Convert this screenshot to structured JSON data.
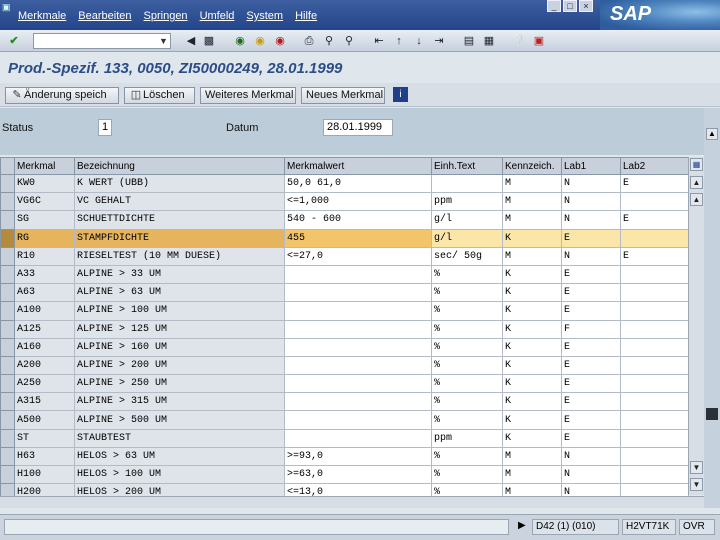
{
  "menu": [
    "Merkmale",
    "Bearbeiten",
    "Springen",
    "Umfeld",
    "System",
    "Hilfe"
  ],
  "brand": "SAP",
  "title": "Prod.-Spezif. 133, 0050, ZI50000249, 28.01.1999",
  "buttons": {
    "change_save": "Änderung speich",
    "delete": "Löschen",
    "more_feature": "Weiteres Merkmal",
    "new_feature": "Neues Merkmal"
  },
  "header": {
    "status_label": "Status",
    "status_value": "1",
    "date_label": "Datum",
    "date_value": "28.01.1999"
  },
  "table": {
    "columns": [
      "Merkmal",
      "Bezeichnung",
      "Merkmalwert",
      "Einh.Text",
      "Kennzeich.",
      "Lab1",
      "Lab2"
    ],
    "rows": [
      [
        "KW0",
        "K WERT (UBB)",
        "50,0   61,0",
        "",
        "M",
        "N",
        "E"
      ],
      [
        "VG6C",
        "VC GEHALT",
        "<=1,000",
        "ppm",
        "M",
        "N",
        ""
      ],
      [
        "SG",
        "SCHUETTDICHTE",
        "540 - 600",
        "g/l",
        "M",
        "N",
        "E"
      ],
      [
        "RG",
        "STAMPFDICHTE",
        "455",
        "g/l",
        "K",
        "E",
        ""
      ],
      [
        "R10",
        "RIESELTEST (10 MM DUESE)",
        "<=27,0",
        "sec/ 50g",
        "M",
        "N",
        "E"
      ],
      [
        "A33",
        "ALPINE >  33 UM",
        "",
        "%",
        "K",
        "E",
        ""
      ],
      [
        "A63",
        "ALPINE >  63 UM",
        "",
        "%",
        "K",
        "E",
        ""
      ],
      [
        "A100",
        "ALPINE > 100 UM",
        "",
        "%",
        "K",
        "E",
        ""
      ],
      [
        "A125",
        "ALPINE > 125 UM",
        "",
        "%",
        "K",
        "F",
        ""
      ],
      [
        "A160",
        "ALPINE > 160 UM",
        "",
        "%",
        "K",
        "E",
        ""
      ],
      [
        "A200",
        "ALPINE > 200 UM",
        "",
        "%",
        "K",
        "E",
        ""
      ],
      [
        "A250",
        "ALPINE > 250 UM",
        "",
        "%",
        "K",
        "E",
        ""
      ],
      [
        "A315",
        "ALPINE > 315 UM",
        "",
        "%",
        "K",
        "E",
        ""
      ],
      [
        "A500",
        "ALPINE > 500 UM",
        "",
        "%",
        "K",
        "E",
        ""
      ],
      [
        "ST",
        "STAUBTEST",
        "",
        "ppm",
        "K",
        "E",
        ""
      ],
      [
        "H63",
        "HELOS >  63 UM",
        ">=93,0",
        "%",
        "M",
        "N",
        ""
      ],
      [
        "H100",
        "HELOS > 100 UM",
        ">=63,0",
        "%",
        "M",
        "N",
        ""
      ],
      [
        "H200",
        "HELOS > 200 UM",
        "<=13,0",
        "%",
        "M",
        "N",
        ""
      ]
    ],
    "selected_row_index": 3
  },
  "status": {
    "session": "D42 (1) (010)",
    "server": "H2VT71K",
    "mode": "OVR"
  },
  "colors": {
    "accent": "#2c4d85",
    "highlight": "#f4c46a",
    "menubar": "#2e4f92"
  },
  "icons": {
    "toolbar": [
      "enter-icon",
      "back-icon",
      "save-icon",
      "green-back-icon",
      "exit-icon",
      "cancel-icon",
      "print-icon",
      "find-icon",
      "find-next-icon",
      "first-page-icon",
      "prev-page-icon",
      "next-page-icon",
      "last-page-icon",
      "create-session-icon",
      "shortcut-icon",
      "help-icon",
      "layout-icon"
    ]
  }
}
